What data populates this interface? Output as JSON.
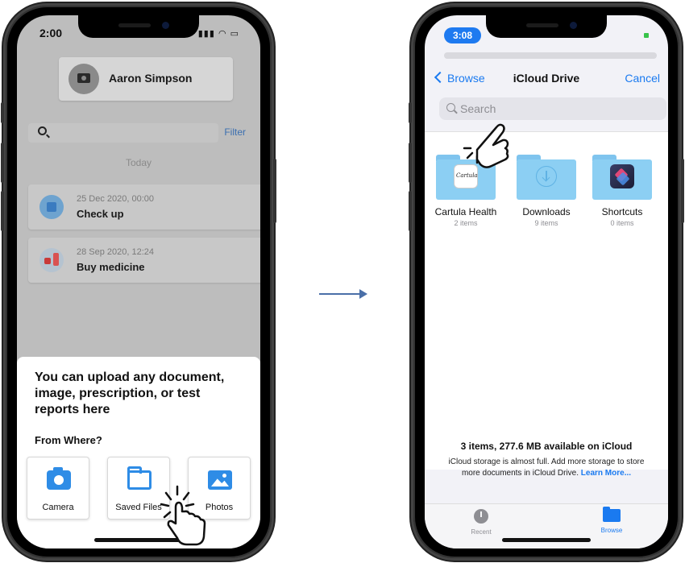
{
  "left_phone": {
    "status_time": "2:00",
    "profile_name": "Aaron Simpson",
    "filter_label": "Filter",
    "section_label": "Today",
    "events": [
      {
        "date": "25 Dec 2020, 00:00",
        "title": "Check up",
        "icon": "calendar-icon"
      },
      {
        "date": "28 Sep 2020, 12:24",
        "title": "Buy medicine",
        "icon": "medicine-icon"
      }
    ],
    "sheet": {
      "heading": "You can upload any document, image, prescription, or test reports here",
      "subheading": "From Where?",
      "options": [
        {
          "label": "Camera",
          "icon": "camera-icon"
        },
        {
          "label": "Saved Files",
          "icon": "folder-icon"
        },
        {
          "label": "Photos",
          "icon": "photos-icon"
        }
      ]
    }
  },
  "right_phone": {
    "status_time": "3:08",
    "nav": {
      "back_label": "Browse",
      "title": "iCloud Drive",
      "cancel_label": "Cancel"
    },
    "search_placeholder": "Search",
    "folders": [
      {
        "name": "Cartula Health",
        "count": "2 items",
        "icon": "cartula-app-icon"
      },
      {
        "name": "Downloads",
        "count": "9 items",
        "icon": "download-icon"
      },
      {
        "name": "Shortcuts",
        "count": "0 items",
        "icon": "shortcuts-app-icon"
      }
    ],
    "storage_summary": "3 items, 277.6 MB available on iCloud",
    "storage_note": "iCloud storage is almost full. Add more storage to store more documents in iCloud Drive.",
    "learn_more": "Learn More...",
    "tabs": [
      {
        "label": "Recent",
        "icon": "clock-icon",
        "active": false
      },
      {
        "label": "Browse",
        "icon": "folder-icon",
        "active": true
      }
    ]
  },
  "colors": {
    "accent": "#1a7af0",
    "sheet_icon": "#2e8ce6",
    "dim_overlay": "#bdbdbd",
    "folder": "#8ccff3"
  }
}
